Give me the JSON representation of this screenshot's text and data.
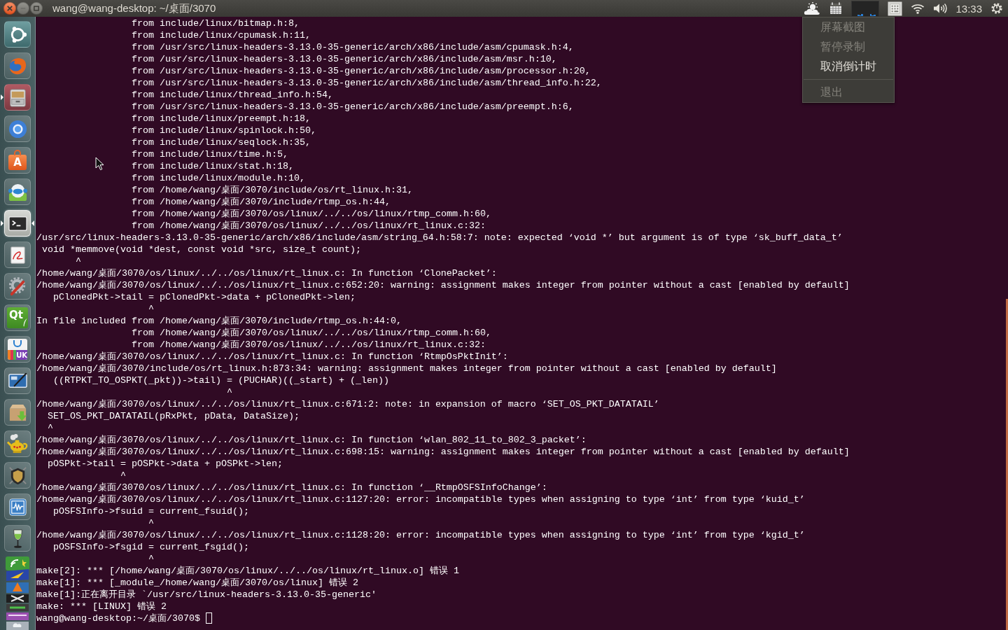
{
  "window": {
    "title": "wang@wang-desktop: ~/桌面/3070"
  },
  "top_panel": {
    "indicators": [
      {
        "kind": "recorder"
      },
      {
        "kind": "calendar"
      },
      {
        "kind": "load_graph"
      },
      {
        "kind": "keyboard"
      },
      {
        "kind": "wifi"
      },
      {
        "kind": "volume"
      },
      {
        "kind": "clock",
        "label": "13:33"
      },
      {
        "kind": "session"
      }
    ]
  },
  "menu": {
    "items": [
      {
        "kind": "item",
        "label": "屏幕截图",
        "disabled": true
      },
      {
        "kind": "item",
        "label": "暂停录制",
        "disabled": true
      },
      {
        "kind": "item",
        "label": "取消倒计时",
        "disabled": false
      },
      {
        "kind": "separator"
      },
      {
        "kind": "item",
        "label": "退出",
        "disabled": true
      }
    ]
  },
  "launcher": {
    "items": [
      {
        "kind": "dash",
        "running": false,
        "active": false
      },
      {
        "kind": "browser",
        "running": false,
        "active": false
      },
      {
        "kind": "files",
        "running": true,
        "active": false
      },
      {
        "kind": "chromium",
        "running": false,
        "active": false
      },
      {
        "kind": "software",
        "label": "A",
        "running": false,
        "active": false
      },
      {
        "kind": "robot",
        "running": false,
        "active": false
      },
      {
        "kind": "terminal",
        "running": true,
        "active": true
      },
      {
        "kind": "reader",
        "running": false,
        "active": false
      },
      {
        "kind": "settings",
        "running": false,
        "active": false
      },
      {
        "kind": "qt",
        "label": "Qt",
        "running": false,
        "active": false
      },
      {
        "kind": "store",
        "label": "UK",
        "running": false,
        "active": false
      },
      {
        "kind": "screen",
        "running": false,
        "active": false
      },
      {
        "kind": "package",
        "running": false,
        "active": false
      },
      {
        "kind": "lamp",
        "running": false,
        "active": false
      },
      {
        "kind": "shield",
        "running": false,
        "active": false
      },
      {
        "kind": "monitor",
        "running": false,
        "active": false
      },
      {
        "kind": "wineglass",
        "running": false,
        "active": false
      }
    ]
  },
  "terminal": {
    "lines": [
      "                 from include/linux/bitmap.h:8,",
      "                 from include/linux/cpumask.h:11,",
      "                 from /usr/src/linux-headers-3.13.0-35-generic/arch/x86/include/asm/cpumask.h:4,",
      "                 from /usr/src/linux-headers-3.13.0-35-generic/arch/x86/include/asm/msr.h:10,",
      "                 from /usr/src/linux-headers-3.13.0-35-generic/arch/x86/include/asm/processor.h:20,",
      "                 from /usr/src/linux-headers-3.13.0-35-generic/arch/x86/include/asm/thread_info.h:22,",
      "                 from include/linux/thread_info.h:54,",
      "                 from /usr/src/linux-headers-3.13.0-35-generic/arch/x86/include/asm/preempt.h:6,",
      "                 from include/linux/preempt.h:18,",
      "                 from include/linux/spinlock.h:50,",
      "                 from include/linux/seqlock.h:35,",
      "                 from include/linux/time.h:5,",
      "                 from include/linux/stat.h:18,",
      "                 from include/linux/module.h:10,",
      "                 from /home/wang/桌面/3070/include/os/rt_linux.h:31,",
      "                 from /home/wang/桌面/3070/include/rtmp_os.h:44,",
      "                 from /home/wang/桌面/3070/os/linux/../../os/linux/rtmp_comm.h:60,",
      "                 from /home/wang/桌面/3070/os/linux/../../os/linux/rt_linux.c:32:",
      "/usr/src/linux-headers-3.13.0-35-generic/arch/x86/include/asm/string_64.h:58:7: note: expected ‘void *’ but argument is of type ‘sk_buff_data_t’",
      " void *memmove(void *dest, const void *src, size_t count);",
      "       ^",
      "/home/wang/桌面/3070/os/linux/../../os/linux/rt_linux.c: In function ‘ClonePacket’:",
      "/home/wang/桌面/3070/os/linux/../../os/linux/rt_linux.c:652:20: warning: assignment makes integer from pointer without a cast [enabled by default]",
      "   pClonedPkt->tail = pClonedPkt->data + pClonedPkt->len;",
      "                    ^",
      "In file included from /home/wang/桌面/3070/include/rtmp_os.h:44:0,",
      "                 from /home/wang/桌面/3070/os/linux/../../os/linux/rtmp_comm.h:60,",
      "                 from /home/wang/桌面/3070/os/linux/../../os/linux/rt_linux.c:32:",
      "/home/wang/桌面/3070/os/linux/../../os/linux/rt_linux.c: In function ‘RtmpOsPktInit’:",
      "/home/wang/桌面/3070/include/os/rt_linux.h:873:34: warning: assignment makes integer from pointer without a cast [enabled by default]",
      "   ((RTPKT_TO_OSPKT(_pkt))->tail) = (PUCHAR)((_start) + (_len))",
      "                                  ^",
      "/home/wang/桌面/3070/os/linux/../../os/linux/rt_linux.c:671:2: note: in expansion of macro ‘SET_OS_PKT_DATATAIL’",
      "  SET_OS_PKT_DATATAIL(pRxPkt, pData, DataSize);",
      "  ^",
      "/home/wang/桌面/3070/os/linux/../../os/linux/rt_linux.c: In function ‘wlan_802_11_to_802_3_packet’:",
      "/home/wang/桌面/3070/os/linux/../../os/linux/rt_linux.c:698:15: warning: assignment makes integer from pointer without a cast [enabled by default]",
      "  pOSPkt->tail = pOSPkt->data + pOSPkt->len;",
      "               ^",
      "/home/wang/桌面/3070/os/linux/../../os/linux/rt_linux.c: In function ‘__RtmpOSFSInfoChange’:",
      "/home/wang/桌面/3070/os/linux/../../os/linux/rt_linux.c:1127:20: error: incompatible types when assigning to type ‘int’ from type ‘kuid_t’",
      "   pOSFSInfo->fsuid = current_fsuid();",
      "                    ^",
      "/home/wang/桌面/3070/os/linux/../../os/linux/rt_linux.c:1128:20: error: incompatible types when assigning to type ‘int’ from type ‘kgid_t’",
      "   pOSFSInfo->fsgid = current_fsgid();",
      "                    ^",
      "make[2]: *** [/home/wang/桌面/3070/os/linux/../../os/linux/rt_linux.o] 错误 1",
      "make[1]: *** [_module_/home/wang/桌面/3070/os/linux] 错误 2",
      "make[1]:正在离开目录 `/usr/src/linux-headers-3.13.0-35-generic'",
      "make: *** [LINUX] 错误 2"
    ],
    "prompt": "wang@wang-desktop:~/桌面/3070$"
  }
}
